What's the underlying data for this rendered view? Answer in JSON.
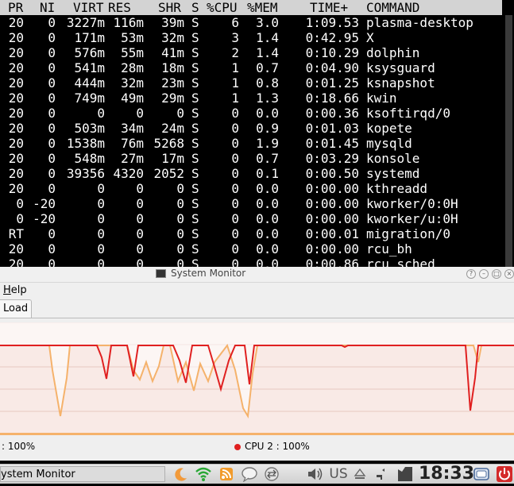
{
  "terminal": {
    "headers": [
      "PR",
      "NI",
      "VIRT",
      "RES",
      "SHR",
      "S",
      "%CPU",
      "%MEM",
      "TIME+",
      "COMMAND"
    ],
    "rows": [
      [
        "20",
        "0",
        "3227m",
        "116m",
        "39m",
        "S",
        "6",
        "3.0",
        "1:09.53",
        "plasma-desktop"
      ],
      [
        "20",
        "0",
        "171m",
        "53m",
        "32m",
        "S",
        "3",
        "1.4",
        "0:42.95",
        "X"
      ],
      [
        "20",
        "0",
        "576m",
        "55m",
        "41m",
        "S",
        "2",
        "1.4",
        "0:10.29",
        "dolphin"
      ],
      [
        "20",
        "0",
        "541m",
        "28m",
        "18m",
        "S",
        "1",
        "0.7",
        "0:04.90",
        "ksysguard"
      ],
      [
        "20",
        "0",
        "444m",
        "32m",
        "23m",
        "S",
        "1",
        "0.8",
        "0:01.25",
        "ksnapshot"
      ],
      [
        "20",
        "0",
        "749m",
        "49m",
        "29m",
        "S",
        "1",
        "1.3",
        "0:18.66",
        "kwin"
      ],
      [
        "20",
        "0",
        "0",
        "0",
        "0",
        "S",
        "0",
        "0.0",
        "0:00.36",
        "ksoftirqd/0"
      ],
      [
        "20",
        "0",
        "503m",
        "34m",
        "24m",
        "S",
        "0",
        "0.9",
        "0:01.03",
        "kopete"
      ],
      [
        "20",
        "0",
        "1538m",
        "76m",
        "5268",
        "S",
        "0",
        "1.9",
        "0:01.45",
        "mysqld"
      ],
      [
        "20",
        "0",
        "548m",
        "27m",
        "17m",
        "S",
        "0",
        "0.7",
        "0:03.29",
        "konsole"
      ],
      [
        "20",
        "0",
        "39356",
        "4320",
        "2052",
        "S",
        "0",
        "0.1",
        "0:00.50",
        "systemd"
      ],
      [
        "20",
        "0",
        "0",
        "0",
        "0",
        "S",
        "0",
        "0.0",
        "0:00.00",
        "kthreadd"
      ],
      [
        "0",
        "-20",
        "0",
        "0",
        "0",
        "S",
        "0",
        "0.0",
        "0:00.00",
        "kworker/0:0H"
      ],
      [
        "0",
        "-20",
        "0",
        "0",
        "0",
        "S",
        "0",
        "0.0",
        "0:00.00",
        "kworker/u:0H"
      ],
      [
        "RT",
        "0",
        "0",
        "0",
        "0",
        "S",
        "0",
        "0.0",
        "0:00.01",
        "migration/0"
      ],
      [
        "20",
        "0",
        "0",
        "0",
        "0",
        "S",
        "0",
        "0.0",
        "0:00.00",
        "rcu_bh"
      ],
      [
        "20",
        "0",
        "0",
        "0",
        "0",
        "S",
        "0",
        "0.0",
        "0:00.86",
        "rcu_sched"
      ]
    ]
  },
  "system_monitor": {
    "window_title": "System Monitor",
    "menu": {
      "help_first": "H",
      "help_rest": "elp"
    },
    "tab_label": "Load",
    "legend": {
      "cpu1_text": ": 100%",
      "cpu2_text": "CPU 2 : 100%",
      "cpu1_color": "#f5b26b",
      "cpu2_color": "#e02020"
    },
    "colors": {
      "graph_bg": "#f9eae6",
      "grid": "#e7c8c0"
    }
  },
  "taskbar": {
    "task_label": "ystem Monitor",
    "keyboard_layout": "US",
    "clock": "18:33",
    "icons": [
      "moon-icon",
      "wifi-icon",
      "rss-icon",
      "chat-icon",
      "network-icon",
      "volume-icon",
      "keyboard-icon",
      "eject-icon",
      "battery-icon",
      "screen-lock-icon",
      "power-icon"
    ]
  }
}
